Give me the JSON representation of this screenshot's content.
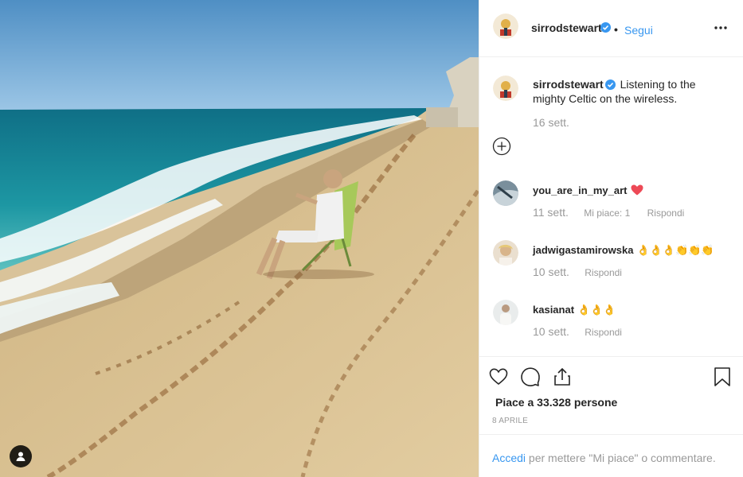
{
  "post": {
    "username": "sirrodstewart",
    "follow_label": "Segui",
    "separator": "•",
    "caption_username": "sirrodstewart",
    "caption_text": "Listening to the mighty Celtic on the wireless.",
    "caption_time": "16 sett."
  },
  "comments": [
    {
      "username": "you_are_in_my_art",
      "emoji": "heart",
      "time": "11 sett.",
      "likes": "Mi piace: 1",
      "reply": "Rispondi"
    },
    {
      "username": "jadwigastamirowska",
      "emoji": "👌👌👌👏👏👏",
      "time": "10 sett.",
      "reply": "Rispondi"
    },
    {
      "username": "kasianat",
      "emoji": "👌👌👌",
      "time": "10 sett.",
      "reply": "Rispondi"
    }
  ],
  "actions": {
    "likes_text": "Piace a 33.328 persone",
    "date": "8 APRILE"
  },
  "login": {
    "link": "Accedi",
    "rest": " per mettere \"Mi piace\" o commentare."
  },
  "icons": {
    "verified": "verified-badge-icon",
    "more": "more-options-icon",
    "load_more": "load-more-comments-icon",
    "like": "heart-icon",
    "comment": "comment-icon",
    "share": "share-icon",
    "save": "bookmark-icon",
    "user_tag": "user-tag-icon"
  },
  "colors": {
    "link_blue": "#3897f0",
    "verified_blue": "#3897f0",
    "heart_red": "#ed4956",
    "muted": "#999999",
    "text": "#262626",
    "border": "#efefef"
  }
}
